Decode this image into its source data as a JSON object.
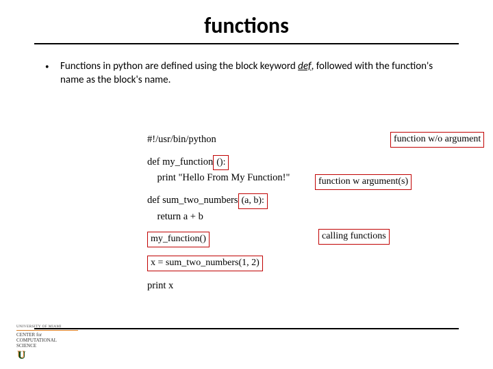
{
  "title": "functions",
  "bullet_point": {
    "text_before": "Functions in python are defined using the block keyword ",
    "def_word": "def",
    "text_after": ", followed with the function's name as the block's name."
  },
  "code": {
    "shebang": "#!/usr/bin/python",
    "def1_keyword": "def my_function",
    "def1_args": "():",
    "def1_body": "    print \"Hello From My Function!\"",
    "def2_keyword": "def sum_two_numbers",
    "def2_args": "(a, b):",
    "def2_body": "    return a + b",
    "call1": "my_function()",
    "call2": "x = sum_two_numbers(1, 2)",
    "print_stmt": "print x"
  },
  "annotations": {
    "a1": "function w/o argument",
    "a2": "function w argument(s)",
    "a3": "calling functions"
  },
  "footer": {
    "university": "UNIVERSITY OF MIAMI",
    "center1": "CENTER for",
    "center2": "COMPUTATIONAL",
    "center3": "SCIENCE",
    "u": "U"
  }
}
